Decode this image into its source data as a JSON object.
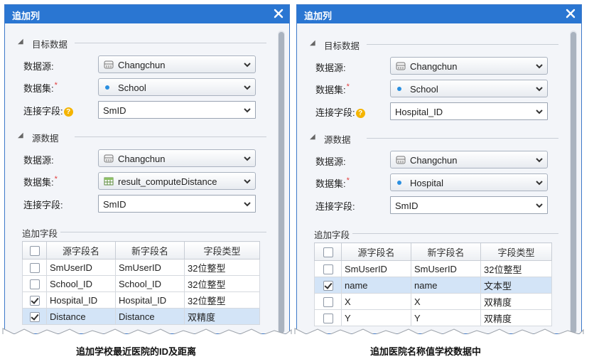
{
  "left_dialog": {
    "title": "追加列",
    "target_section": "目标数据",
    "target": {
      "datasource_label": "数据源:",
      "datasource_value": "Changchun",
      "dataset_label": "数据集:",
      "dataset_value": "School",
      "join_field_label": "连接字段:",
      "join_field_value": "SmID"
    },
    "source_section": "源数据",
    "source": {
      "datasource_label": "数据源:",
      "datasource_value": "Changchun",
      "dataset_label": "数据集:",
      "dataset_value": "result_computeDistance",
      "join_field_label": "连接字段:",
      "join_field_value": "SmID"
    },
    "append_fields_label": "追加字段",
    "columns": [
      "源字段名",
      "新字段名",
      "字段类型"
    ],
    "rows": [
      {
        "checked": false,
        "source": "SmUserID",
        "new": "SmUserID",
        "type": "32位整型",
        "selected": false
      },
      {
        "checked": false,
        "source": "School_ID",
        "new": "School_ID",
        "type": "32位整型",
        "selected": false
      },
      {
        "checked": true,
        "source": "Hospital_ID",
        "new": "Hospital_ID",
        "type": "32位整型",
        "selected": false
      },
      {
        "checked": true,
        "source": "Distance",
        "new": "Distance",
        "type": "双精度",
        "selected": true
      }
    ]
  },
  "right_dialog": {
    "title": "追加列",
    "target_section": "目标数据",
    "target": {
      "datasource_label": "数据源:",
      "datasource_value": "Changchun",
      "dataset_label": "数据集:",
      "dataset_value": "School",
      "join_field_label": "连接字段:",
      "join_field_value": "Hospital_ID"
    },
    "source_section": "源数据",
    "source": {
      "datasource_label": "数据源:",
      "datasource_value": "Changchun",
      "dataset_label": "数据集:",
      "dataset_value": "Hospital",
      "join_field_label": "连接字段:",
      "join_field_value": "SmID"
    },
    "append_fields_label": "追加字段",
    "columns": [
      "源字段名",
      "新字段名",
      "字段类型"
    ],
    "rows": [
      {
        "checked": false,
        "source": "SmUserID",
        "new": "SmUserID",
        "type": "32位整型",
        "selected": false
      },
      {
        "checked": true,
        "source": "name",
        "new": "name",
        "type": "文本型",
        "selected": true
      },
      {
        "checked": false,
        "source": "X",
        "new": "X",
        "type": "双精度",
        "selected": false
      },
      {
        "checked": false,
        "source": "Y",
        "new": "Y",
        "type": "双精度",
        "selected": false
      }
    ]
  },
  "captions": {
    "left": "追加学校最近医院的ID及距离",
    "right": "追加医院名称值学校数据中"
  },
  "colors": {
    "titlebar": "#2a76d2",
    "selected_row": "#d3e4f7",
    "required_mark": "#e23b3b",
    "help_icon": "#f4b400",
    "point_dot": "#2a8fe0"
  }
}
